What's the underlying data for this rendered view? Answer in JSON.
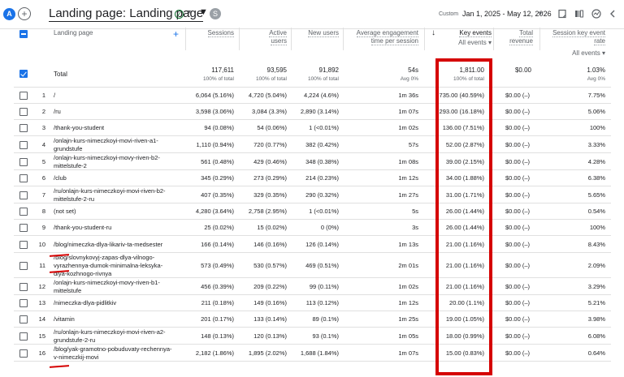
{
  "topbar": {
    "avatar_letter": "A",
    "add_glyph": "+",
    "title": "Landing page: Landing page",
    "status_glyph": "✓",
    "caret_glyph": "▾",
    "filter_glyph": "▼",
    "user_letter": "S",
    "date_label": "Custom",
    "date_range": "Jan 1, 2025 - May 12, 2026",
    "icons": [
      "edit-icon",
      "compare-icon",
      "insights-icon",
      "share-icon"
    ]
  },
  "headers": {
    "landing_page": "Landing page",
    "sessions": "Sessions",
    "active_users_1": "Active",
    "active_users_2": "users",
    "new_users": "New users",
    "avg_eng_1": "Average engagement",
    "avg_eng_2": "time per session",
    "key_events": "Key events",
    "all_events": "All events ▾",
    "total_revenue_1": "Total",
    "total_revenue_2": "revenue",
    "skr_1": "Session key event",
    "skr_2": "rate",
    "skr_all_events": "All events ▾"
  },
  "total": {
    "label": "Total",
    "sessions": "117,611",
    "sessions_sub": "100% of total",
    "active_users": "93,595",
    "active_users_sub": "100% of total",
    "new_users": "91,892",
    "new_users_sub": "100% of total",
    "avg_eng": "54s",
    "avg_eng_sub": "Avg 0%",
    "key_events": "1,811.00",
    "key_events_sub": "100% of total",
    "revenue": "$0.00",
    "rate": "1.03%",
    "rate_sub": "Avg 0%"
  },
  "rows": [
    {
      "num": "1",
      "lp": "/",
      "sessions": "6,064 (5.16%)",
      "active": "4,720 (5.04%)",
      "new": "4,224 (4.6%)",
      "eng": "1m 36s",
      "key": "735.00 (40.59%)",
      "rev": "$0.00 (–)",
      "rate": "7.75%"
    },
    {
      "num": "2",
      "lp": "/ru",
      "sessions": "3,598 (3.06%)",
      "active": "3,084 (3.3%)",
      "new": "2,890 (3.14%)",
      "eng": "1m 07s",
      "key": "293.00 (16.18%)",
      "rev": "$0.00 (–)",
      "rate": "5.06%"
    },
    {
      "num": "3",
      "lp": "/thank-you-student",
      "sessions": "94 (0.08%)",
      "active": "54 (0.06%)",
      "new": "1 (<0.01%)",
      "eng": "1m 02s",
      "key": "136.00 (7.51%)",
      "rev": "$0.00 (–)",
      "rate": "100%"
    },
    {
      "num": "4",
      "lp": "/onlajn-kurs-nimeczkoyi-movi-riven-a1-grundstufe",
      "sessions": "1,110 (0.94%)",
      "active": "720 (0.77%)",
      "new": "382 (0.42%)",
      "eng": "57s",
      "key": "52.00 (2.87%)",
      "rev": "$0.00 (–)",
      "rate": "3.33%"
    },
    {
      "num": "5",
      "lp": "/onlajn-kurs-nimeczkoyi-movy-riven-b2-mittelstufe-2",
      "sessions": "561 (0.48%)",
      "active": "429 (0.46%)",
      "new": "348 (0.38%)",
      "eng": "1m 08s",
      "key": "39.00 (2.15%)",
      "rev": "$0.00 (–)",
      "rate": "4.28%"
    },
    {
      "num": "6",
      "lp": "/club",
      "sessions": "345 (0.29%)",
      "active": "273 (0.29%)",
      "new": "214 (0.23%)",
      "eng": "1m 12s",
      "key": "34.00 (1.88%)",
      "rev": "$0.00 (–)",
      "rate": "6.38%"
    },
    {
      "num": "7",
      "lp": "/ru/onlajn-kurs-nimeczkoyi-movi-riven-b2-mittelstufe-2-ru",
      "sessions": "407 (0.35%)",
      "active": "329 (0.35%)",
      "new": "290 (0.32%)",
      "eng": "1m 27s",
      "key": "31.00 (1.71%)",
      "rev": "$0.00 (–)",
      "rate": "5.65%"
    },
    {
      "num": "8",
      "lp": "(not set)",
      "sessions": "4,280 (3.64%)",
      "active": "2,758 (2.95%)",
      "new": "1 (<0.01%)",
      "eng": "5s",
      "key": "26.00 (1.44%)",
      "rev": "$0.00 (–)",
      "rate": "0.54%"
    },
    {
      "num": "9",
      "lp": "/thank-you-student-ru",
      "sessions": "25 (0.02%)",
      "active": "15 (0.02%)",
      "new": "0 (0%)",
      "eng": "3s",
      "key": "26.00 (1.44%)",
      "rev": "$0.00 (–)",
      "rate": "100%"
    },
    {
      "num": "10",
      "lp": "/blog/nimeczka-dlya-likariv-ta-medsester",
      "sessions": "166 (0.14%)",
      "active": "146 (0.16%)",
      "new": "126 (0.14%)",
      "eng": "1m 13s",
      "key": "21.00 (1.16%)",
      "rev": "$0.00 (–)",
      "rate": "8.43%"
    },
    {
      "num": "11",
      "lp": "/blog/slovnykovyj-zapas-dlya-vilnogo-vyrazhennya-dumok-minimalna-leksyka-dlya-kozhnogo-rivnya",
      "sessions": "573 (0.49%)",
      "active": "530 (0.57%)",
      "new": "469 (0.51%)",
      "eng": "2m 01s",
      "key": "21.00 (1.16%)",
      "rev": "$0.00 (–)",
      "rate": "2.09%"
    },
    {
      "num": "12",
      "lp": "/onlajn-kurs-nimeczkoyi-movy-riven-b1-mittelstufe",
      "sessions": "456 (0.39%)",
      "active": "209 (0.22%)",
      "new": "99 (0.11%)",
      "eng": "1m 02s",
      "key": "21.00 (1.16%)",
      "rev": "$0.00 (–)",
      "rate": "3.29%"
    },
    {
      "num": "13",
      "lp": "/nimeczka-dlya-pidlitkiv",
      "sessions": "211 (0.18%)",
      "active": "149 (0.16%)",
      "new": "113 (0.12%)",
      "eng": "1m 12s",
      "key": "20.00 (1.1%)",
      "rev": "$0.00 (–)",
      "rate": "5.21%"
    },
    {
      "num": "14",
      "lp": "/vitamin",
      "sessions": "201 (0.17%)",
      "active": "133 (0.14%)",
      "new": "89 (0.1%)",
      "eng": "1m 25s",
      "key": "19.00 (1.05%)",
      "rev": "$0.00 (–)",
      "rate": "3.98%"
    },
    {
      "num": "15",
      "lp": "/ru/onlajn-kurs-nimeczkoyi-movi-riven-a2-grundstufe-2-ru",
      "sessions": "148 (0.13%)",
      "active": "120 (0.13%)",
      "new": "93 (0.1%)",
      "eng": "1m 05s",
      "key": "18.00 (0.99%)",
      "rev": "$0.00 (–)",
      "rate": "6.08%"
    },
    {
      "num": "16",
      "lp": "/blog/yak-gramotno-pobuduvaty-rechennya-v-nimeczkij-movi",
      "sessions": "2,182 (1.86%)",
      "active": "1,895 (2.02%)",
      "new": "1,688 (1.84%)",
      "eng": "1m 07s",
      "key": "15.00 (0.83%)",
      "rev": "$0.00 (–)",
      "rate": "0.64%"
    }
  ],
  "colors": {
    "accent": "#1a73e8",
    "highlight": "#d50000"
  }
}
